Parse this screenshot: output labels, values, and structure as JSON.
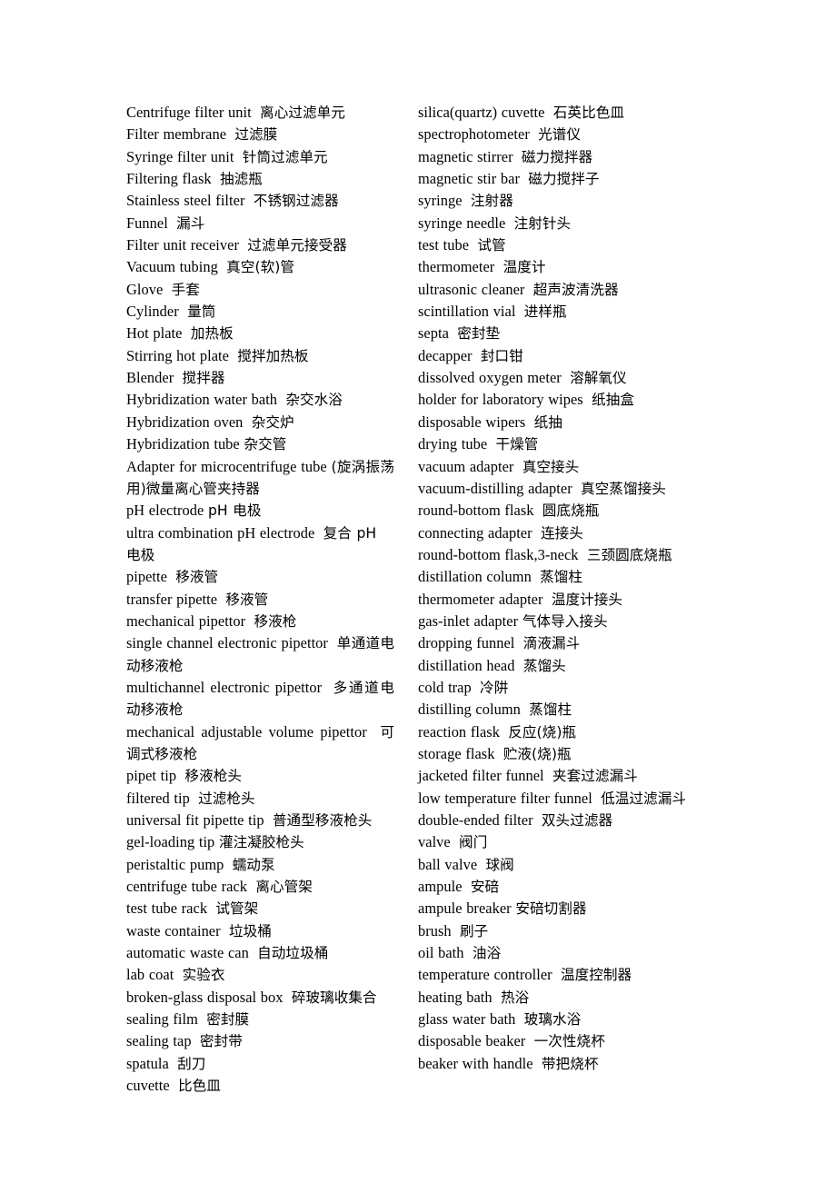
{
  "document": {
    "title": "Laboratory Equipment Glossary (English-Chinese)",
    "layout": "two-column",
    "background_color": "#ffffff",
    "text_color": "#000000"
  },
  "columns": {
    "left": {
      "entries": [
        {
          "en": "Centrifuge filter unit",
          "zh": "离心过滤单元",
          "wraps": false
        },
        {
          "en": "Filter membrane",
          "zh": "过滤膜",
          "wraps": false
        },
        {
          "en": "Syringe filter unit",
          "zh": "针筒过滤单元",
          "wraps": false
        },
        {
          "en": "Filtering flask",
          "zh": "抽滤瓶",
          "wraps": false
        },
        {
          "en": "Stainless steel filter",
          "zh": "不锈钢过滤器",
          "wraps": false
        },
        {
          "en": "Funnel",
          "zh": "漏斗",
          "wraps": false
        },
        {
          "en": "Filter unit receiver",
          "zh": "过滤单元接受器",
          "wraps": false
        },
        {
          "en": "Vacuum tubing",
          "zh": "真空(软)管",
          "wraps": false
        },
        {
          "en": "Glove",
          "zh": "手套",
          "wraps": false
        },
        {
          "en": "Cylinder",
          "zh": "量筒",
          "wraps": false
        },
        {
          "en": "Hot plate",
          "zh": "加热板",
          "wraps": false
        },
        {
          "en": "Stirring hot plate",
          "zh": "搅拌加热板",
          "wraps": false
        },
        {
          "en": "Blender",
          "zh": "搅拌器",
          "wraps": false
        },
        {
          "en": "Hybridization water bath",
          "zh": "杂交水浴",
          "wraps": false
        },
        {
          "en": "Hybridization oven",
          "zh": "杂交炉",
          "wraps": false
        },
        {
          "en": "Hybridization tube",
          "zh": "杂交管",
          "wraps": false,
          "tight": true
        },
        {
          "en": "Adapter for microcentrifuge tube",
          "zh": "(旋涡振荡用)微量离心管夹持器",
          "wraps": true,
          "tight": true
        },
        {
          "en": "pH electrode",
          "zh": "pH 电极",
          "wraps": false,
          "tight": true
        },
        {
          "en": "ultra combination pH electrode",
          "zh": "复合 pH 电极",
          "wraps": false
        },
        {
          "en": "pipette",
          "zh": "移液管",
          "wraps": false
        },
        {
          "en": "transfer pipette",
          "zh": "移液管",
          "wraps": false
        },
        {
          "en": "mechanical pipettor",
          "zh": "移液枪",
          "wraps": false
        },
        {
          "en": "single channel electronic pipettor",
          "zh": "单通道电动移液枪",
          "wraps": true
        },
        {
          "en": "multichannel electronic pipettor",
          "zh": "多通道电动移液枪",
          "wraps": true
        },
        {
          "en": "mechanical adjustable volume pipettor",
          "zh": "可调式移液枪",
          "wraps": true
        },
        {
          "en": "pipet tip",
          "zh": "移液枪头",
          "wraps": false
        },
        {
          "en": "filtered tip",
          "zh": "过滤枪头",
          "wraps": false
        },
        {
          "en": "universal fit pipette tip",
          "zh": "普通型移液枪头",
          "wraps": false
        },
        {
          "en": "gel-loading tip",
          "zh": "灌注凝胶枪头",
          "wraps": false,
          "tight": true
        },
        {
          "en": "peristaltic pump",
          "zh": "蠕动泵",
          "wraps": false
        },
        {
          "en": "centrifuge tube rack",
          "zh": "离心管架",
          "wraps": false
        },
        {
          "en": "test tube rack",
          "zh": "试管架",
          "wraps": false
        },
        {
          "en": "waste container",
          "zh": "垃圾桶",
          "wraps": false
        },
        {
          "en": "automatic waste can",
          "zh": "自动垃圾桶",
          "wraps": false
        },
        {
          "en": "lab coat",
          "zh": "实验衣",
          "wraps": false
        },
        {
          "en": "broken-glass disposal box",
          "zh": "碎玻璃收集合",
          "wraps": false
        },
        {
          "en": "sealing film",
          "zh": "密封膜",
          "wraps": false
        },
        {
          "en": "sealing tap",
          "zh": "密封带",
          "wraps": false
        },
        {
          "en": "spatula",
          "zh": "刮刀",
          "wraps": false
        },
        {
          "en": "cuvette",
          "zh": "比色皿",
          "wraps": false
        }
      ]
    },
    "right": {
      "entries": [
        {
          "en": "silica(quartz) cuvette",
          "zh": "石英比色皿",
          "wraps": false
        },
        {
          "en": "spectrophotometer",
          "zh": "光谱仪",
          "wraps": false
        },
        {
          "en": "magnetic stirrer",
          "zh": "磁力搅拌器",
          "wraps": false
        },
        {
          "en": "magnetic stir bar",
          "zh": "磁力搅拌子",
          "wraps": false
        },
        {
          "en": "syringe",
          "zh": "注射器",
          "wraps": false
        },
        {
          "en": "syringe needle",
          "zh": "注射针头",
          "wraps": false
        },
        {
          "en": "test tube",
          "zh": "试管",
          "wraps": false
        },
        {
          "en": "thermometer",
          "zh": "温度计",
          "wraps": false
        },
        {
          "en": "ultrasonic cleaner",
          "zh": "超声波清洗器",
          "wraps": false
        },
        {
          "en": "scintillation vial",
          "zh": "进样瓶",
          "wraps": false
        },
        {
          "en": "septa",
          "zh": "密封垫",
          "wraps": false
        },
        {
          "en": "decapper",
          "zh": "封口钳",
          "wraps": false
        },
        {
          "en": "dissolved oxygen meter",
          "zh": "溶解氧仪",
          "wraps": false
        },
        {
          "en": "holder for laboratory wipes",
          "zh": "纸抽盒",
          "wraps": false
        },
        {
          "en": "disposable wipers",
          "zh": "纸抽",
          "wraps": false
        },
        {
          "en": "drying tube",
          "zh": "干燥管",
          "wraps": false
        },
        {
          "en": "vacuum adapter",
          "zh": "真空接头",
          "wraps": false
        },
        {
          "en": "vacuum-distilling adapter",
          "zh": "真空蒸馏接头",
          "wraps": false
        },
        {
          "en": "round-bottom flask",
          "zh": "圆底烧瓶",
          "wraps": false
        },
        {
          "en": "connecting adapter",
          "zh": "连接头",
          "wraps": false
        },
        {
          "en": "round-bottom flask,3-neck",
          "zh": "三颈圆底烧瓶",
          "wraps": false
        },
        {
          "en": "distillation column",
          "zh": "蒸馏柱",
          "wraps": false
        },
        {
          "en": "thermometer adapter",
          "zh": "温度计接头",
          "wraps": false
        },
        {
          "en": "gas-inlet adapter",
          "zh": "气体导入接头",
          "wraps": false,
          "tight": true
        },
        {
          "en": "dropping funnel",
          "zh": "滴液漏斗",
          "wraps": false
        },
        {
          "en": "distillation head",
          "zh": "蒸馏头",
          "wraps": false
        },
        {
          "en": "cold trap",
          "zh": "冷阱",
          "wraps": false
        },
        {
          "en": "distilling column",
          "zh": "蒸馏柱",
          "wraps": false
        },
        {
          "en": "reaction flask",
          "zh": "反应(烧)瓶",
          "wraps": false
        },
        {
          "en": "storage flask",
          "zh": "贮液(烧)瓶",
          "wraps": false
        },
        {
          "en": "jacketed filter funnel",
          "zh": "夹套过滤漏斗",
          "wraps": false
        },
        {
          "en": "low temperature filter funnel",
          "zh": "低温过滤漏斗",
          "wraps": false
        },
        {
          "en": "double-ended filter",
          "zh": "双头过滤器",
          "wraps": false
        },
        {
          "en": "valve",
          "zh": "阀门",
          "wraps": false
        },
        {
          "en": "ball valve",
          "zh": "球阀",
          "wraps": false
        },
        {
          "en": "ampule",
          "zh": "安碚",
          "wraps": false
        },
        {
          "en": "ampule breaker",
          "zh": "安碚切割器",
          "wraps": false,
          "tight": true
        },
        {
          "en": "brush",
          "zh": "刷子",
          "wraps": false
        },
        {
          "en": "oil bath",
          "zh": "油浴",
          "wraps": false
        },
        {
          "en": "temperature controller",
          "zh": "温度控制器",
          "wraps": false
        },
        {
          "en": "heating bath",
          "zh": "热浴",
          "wraps": false
        },
        {
          "en": "glass water bath",
          "zh": "玻璃水浴",
          "wraps": false
        },
        {
          "en": "disposable beaker",
          "zh": "一次性烧杯",
          "wraps": false
        },
        {
          "en": "beaker with handle",
          "zh": "带把烧杯",
          "wraps": false
        }
      ]
    }
  }
}
